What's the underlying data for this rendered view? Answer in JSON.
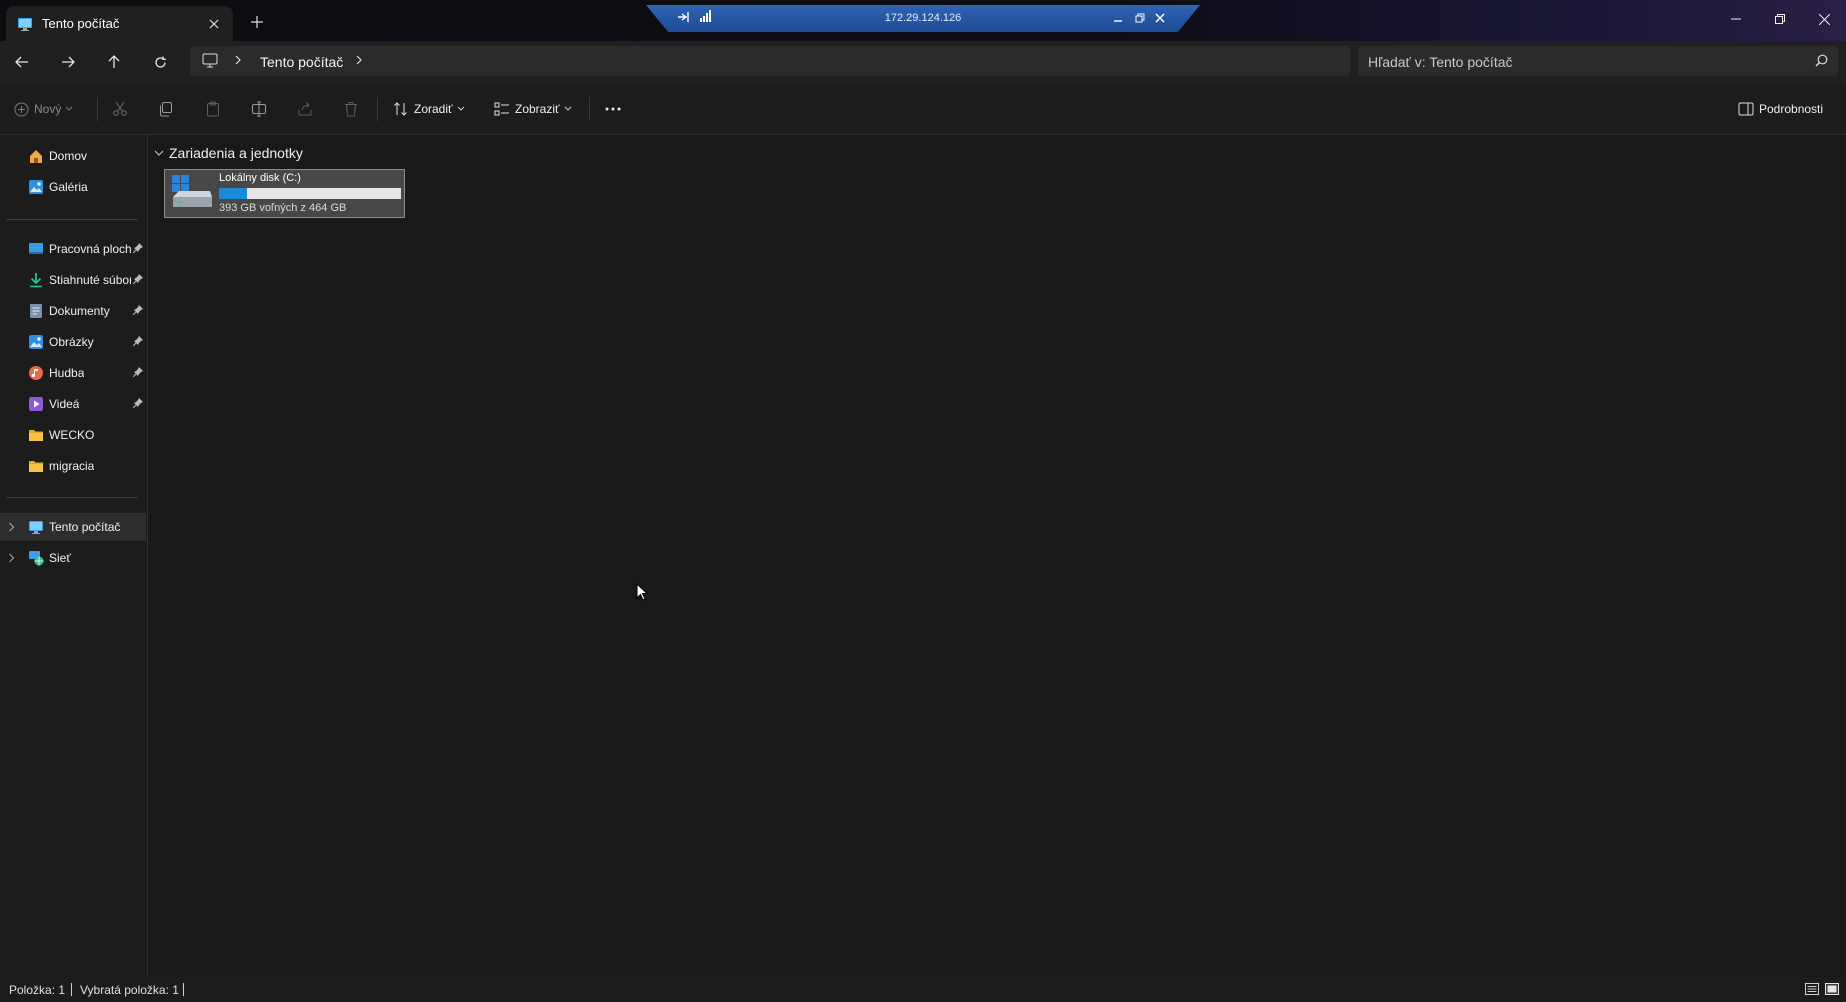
{
  "window": {
    "tab_title": "Tento počítač",
    "tab_icon": "computer-icon",
    "new_tab_icon": "plus-icon"
  },
  "remote_bar": {
    "ip": "172.29.124.126"
  },
  "address_bar": {
    "breadcrumb": "Tento počítač",
    "search_placeholder": "Hľadať v: Tento počítač"
  },
  "toolbar": {
    "new_label": "Nový",
    "sort_label": "Zoradiť",
    "view_label": "Zobraziť",
    "details_label": "Podrobnosti"
  },
  "sidebar": {
    "top": [
      {
        "label": "Domov",
        "icon": "home-icon"
      },
      {
        "label": "Galéria",
        "icon": "gallery-icon"
      }
    ],
    "pinned": [
      {
        "label": "Pracovná plocha",
        "icon": "desktop-icon",
        "pinned": true
      },
      {
        "label": "Stiahnuté súbory",
        "icon": "download-icon",
        "pinned": true
      },
      {
        "label": "Dokumenty",
        "icon": "documents-icon",
        "pinned": true
      },
      {
        "label": "Obrázky",
        "icon": "pictures-icon",
        "pinned": true
      },
      {
        "label": "Hudba",
        "icon": "music-icon",
        "pinned": true
      },
      {
        "label": "Videá",
        "icon": "videos-icon",
        "pinned": true
      },
      {
        "label": "WECKO",
        "icon": "folder-icon",
        "pinned": false
      },
      {
        "label": "migracia",
        "icon": "folder-icon",
        "pinned": false
      }
    ],
    "locations": [
      {
        "label": "Tento počítač",
        "icon": "computer-icon",
        "selected": true
      },
      {
        "label": "Sieť",
        "icon": "network-icon",
        "selected": false
      }
    ]
  },
  "main": {
    "group_label": "Zariadenia a jednotky",
    "drive": {
      "name": "Lokálny disk (C:)",
      "free_text": "393 GB voľných z 464 GB",
      "used_fraction": 0.153
    }
  },
  "status": {
    "items": "Položka: 1",
    "selected": "Vybratá položka: 1"
  },
  "colors": {
    "accent": "#1b8ad8",
    "rdp_bar": "#2f64b4",
    "background": "#191919"
  }
}
